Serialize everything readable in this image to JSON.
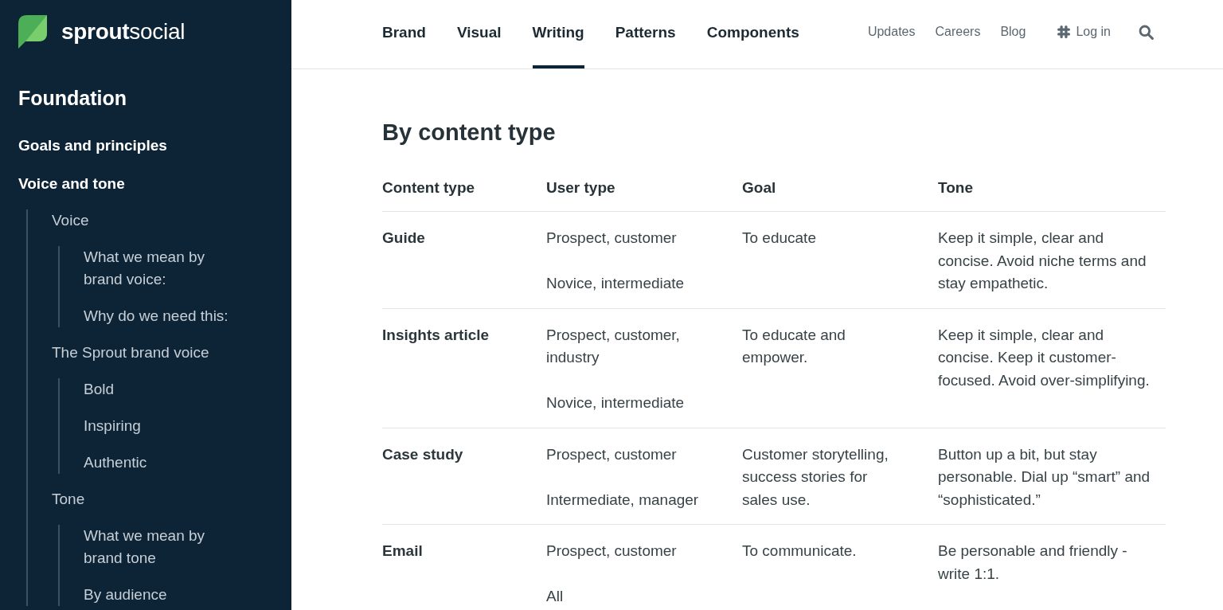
{
  "logo": {
    "wordmark": "**sprout**social"
  },
  "sidebar": {
    "heading": "Foundation",
    "items": [
      {
        "label": "Goals and principles"
      },
      {
        "label": "Voice and tone",
        "children": [
          {
            "label": "Voice",
            "children": [
              {
                "label": "What we mean by brand voice:"
              },
              {
                "label": "Why do we need this:"
              }
            ]
          },
          {
            "label": "The Sprout brand voice",
            "children": [
              {
                "label": "Bold"
              },
              {
                "label": "Inspiring"
              },
              {
                "label": "Authentic"
              }
            ]
          },
          {
            "label": "Tone",
            "children": [
              {
                "label": "What we mean by brand tone"
              },
              {
                "label": "By audience"
              }
            ]
          }
        ]
      }
    ]
  },
  "nav": {
    "tabs": [
      {
        "label": "Brand",
        "selected": false
      },
      {
        "label": "Visual",
        "selected": false
      },
      {
        "label": "Writing",
        "selected": true
      },
      {
        "label": "Patterns",
        "selected": false
      },
      {
        "label": "Components",
        "selected": false
      }
    ],
    "links": [
      {
        "label": "Updates",
        "kind": "link"
      },
      {
        "label": "Careers",
        "kind": "link"
      },
      {
        "label": "Blog",
        "kind": "link"
      },
      {
        "label": "Log in",
        "kind": "slack_link"
      }
    ]
  },
  "content": {
    "heading": "By content type",
    "table": {
      "columns": [
        "Content type",
        "User type",
        "Goal",
        "Tone"
      ],
      "rows": [
        {
          "content_type": "Guide",
          "user_type": [
            "Prospect, customer",
            "Novice, intermediate"
          ],
          "goal": "To educate",
          "tone": "Keep it simple, clear and concise. Avoid niche terms and stay empathetic."
        },
        {
          "content_type": "Insights article",
          "user_type": [
            "Prospect, customer, industry",
            "Novice, intermediate"
          ],
          "goal": "To educate and empower.",
          "tone": "Keep it simple, clear and concise. Keep it customer-focused. Avoid over-simplifying."
        },
        {
          "content_type": "Case study",
          "user_type": [
            "Prospect, customer",
            "Intermediate, manager"
          ],
          "goal": "Customer storytelling, success stories for sales use.",
          "tone": "Button up a bit, but stay personable. Dial up “smart” and “sophisticated.”"
        },
        {
          "content_type": "Email",
          "user_type": [
            "Prospect, customer",
            "All"
          ],
          "goal": "To communicate.",
          "tone": "Be personable and friendly - write 1:1."
        }
      ]
    }
  }
}
